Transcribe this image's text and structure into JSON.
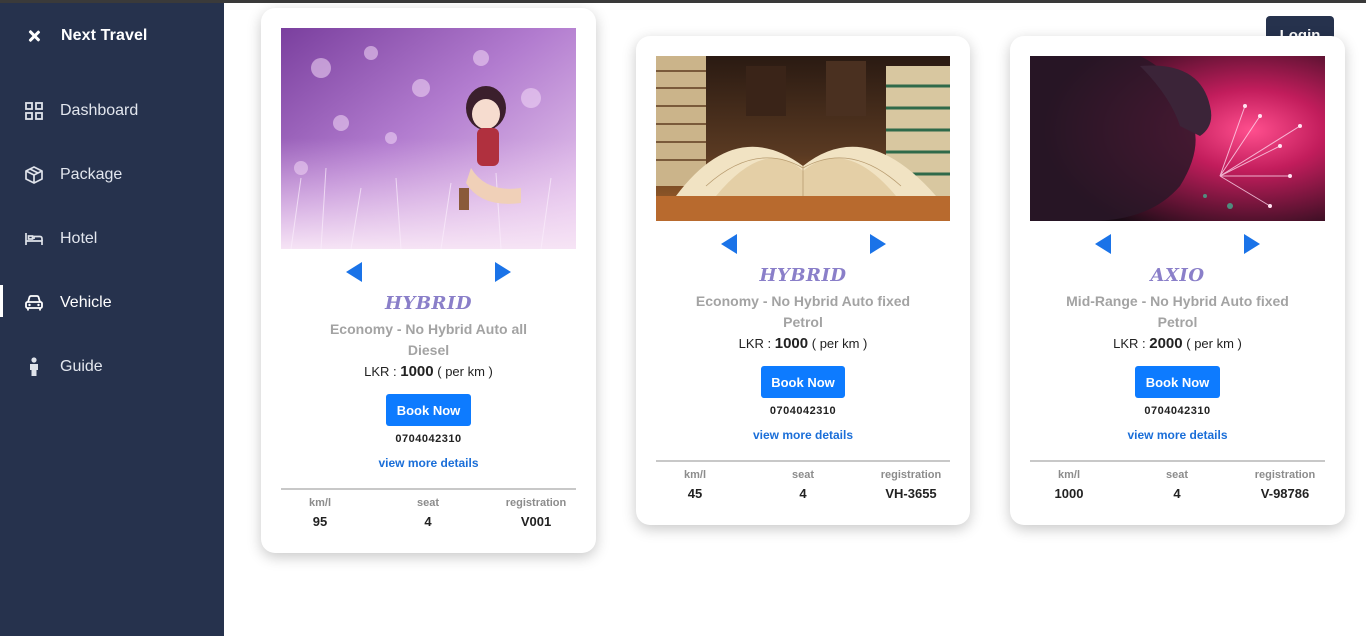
{
  "app": {
    "title": "Next Travel"
  },
  "sidebar": {
    "items": [
      {
        "label": "Dashboard",
        "icon": "grid-icon"
      },
      {
        "label": "Package",
        "icon": "package-box-icon"
      },
      {
        "label": "Hotel",
        "icon": "bed-icon"
      },
      {
        "label": "Vehicle",
        "icon": "car-icon",
        "active": true
      },
      {
        "label": "Guide",
        "icon": "person-icon"
      }
    ]
  },
  "header": {
    "login_label": "Login"
  },
  "cards": [
    {
      "image": "anime-girl-in-flower-field",
      "name": "HYBRID",
      "description": "Economy - No Hybrid Auto all Diesel",
      "price_prefix": "LKR :",
      "price": "1000",
      "price_unit": "( per km )",
      "book_label": "Book Now",
      "phone": "0704042310",
      "more_label": "view more details",
      "stats": [
        {
          "label": "km/l",
          "value": "95"
        },
        {
          "label": "seat",
          "value": "4"
        },
        {
          "label": "registration",
          "value": "V001"
        }
      ]
    },
    {
      "image": "open-books-on-table",
      "name": "HYBRID",
      "description": "Economy - No Hybrid Auto fixed Petrol",
      "price_prefix": "LKR :",
      "price": "1000",
      "price_unit": "( per km )",
      "book_label": "Book Now",
      "phone": "0704042310",
      "more_label": "view more details",
      "stats": [
        {
          "label": "km/l",
          "value": "45"
        },
        {
          "label": "seat",
          "value": "4"
        },
        {
          "label": "registration",
          "value": "VH-3655"
        }
      ]
    },
    {
      "image": "silhouette-with-magenta-flowers",
      "name": "AXIO",
      "description": "Mid-Range - No Hybrid Auto fixed Petrol",
      "price_prefix": "LKR :",
      "price": "2000",
      "price_unit": "( per km )",
      "book_label": "Book Now",
      "phone": "0704042310",
      "more_label": "view more details",
      "stats": [
        {
          "label": "km/l",
          "value": "1000"
        },
        {
          "label": "seat",
          "value": "4"
        },
        {
          "label": "registration",
          "value": "V-98786"
        }
      ]
    }
  ],
  "colors": {
    "sidebar": "#26324d",
    "accent": "#0d7bff",
    "title": "#8a7fc9"
  }
}
